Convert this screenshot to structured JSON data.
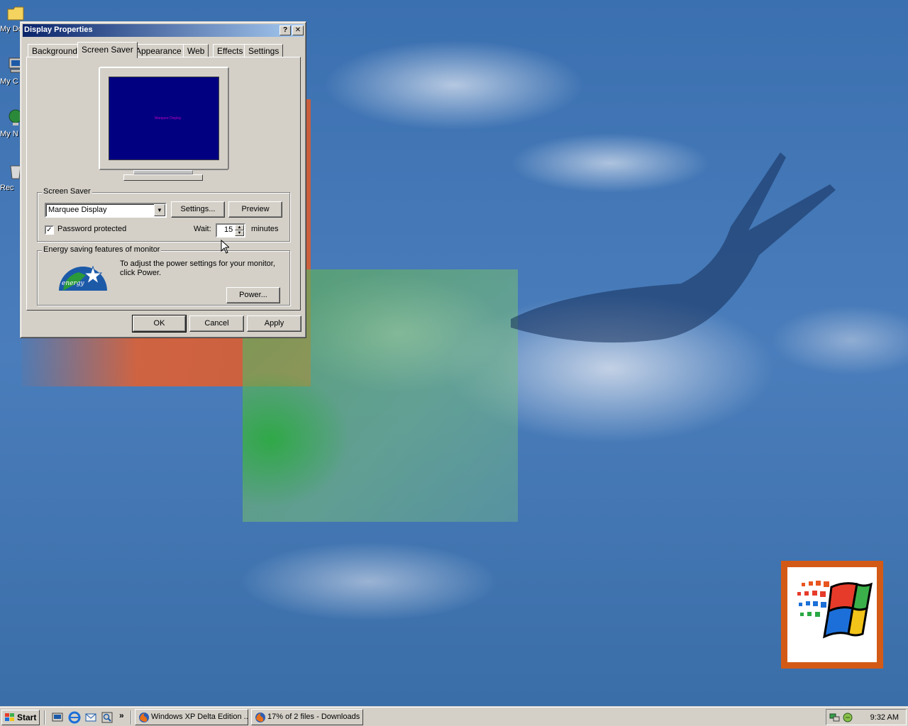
{
  "desktop": {
    "icons": [
      {
        "label": "My Do"
      },
      {
        "label": "My C"
      },
      {
        "label": "My N"
      },
      {
        "label": "Rec"
      }
    ]
  },
  "dialog": {
    "title": "Display Properties",
    "help_label": "?",
    "close_label": "✕",
    "tabs": [
      {
        "label": "Background"
      },
      {
        "label": "Screen Saver"
      },
      {
        "label": "Appearance"
      },
      {
        "label": "Web"
      },
      {
        "label": "Effects"
      },
      {
        "label": "Settings"
      }
    ],
    "active_tab": "Screen Saver",
    "preview_text": "Marquee Display",
    "screen_saver": {
      "group_title": "Screen Saver",
      "selected": "Marquee Display",
      "settings_label": "Settings...",
      "preview_label": "Preview",
      "password_label": "Password protected",
      "password_checked": true,
      "check_mark": "✓",
      "wait_label": "Wait:",
      "wait_value": "15",
      "minutes_label": "minutes"
    },
    "energy": {
      "group_title": "Energy saving features of monitor",
      "description": "To adjust the power settings for your monitor, click Power.",
      "power_label": "Power..."
    },
    "buttons": {
      "ok": "OK",
      "cancel": "Cancel",
      "apply": "Apply"
    }
  },
  "taskbar": {
    "start_label": "Start",
    "more_label": "»",
    "tasks": [
      {
        "label": "Windows XP Delta Edition ...",
        "icon": "firefox-icon"
      },
      {
        "label": "17% of 2 files - Downloads",
        "icon": "firefox-icon"
      }
    ],
    "clock": "9:32 AM"
  }
}
